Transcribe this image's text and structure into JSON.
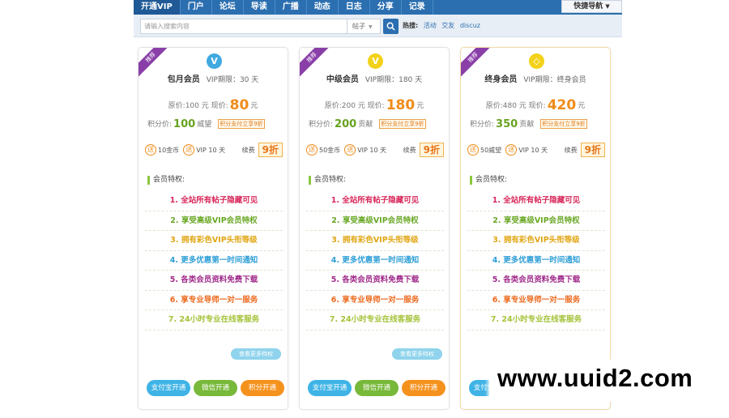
{
  "nav": {
    "items": [
      "开通VIP",
      "门户",
      "论坛",
      "导读",
      "广播",
      "动态",
      "日志",
      "分享",
      "记录"
    ],
    "quick_nav": "快捷导航"
  },
  "search": {
    "placeholder": "请输入搜索内容",
    "scope": "帖子",
    "hot_label": "热搜:",
    "hot_terms": [
      "活动",
      "交友",
      "discuz"
    ]
  },
  "cards": [
    {
      "ribbon": "推荐",
      "badge": "V",
      "badge_color": "#3fa9e0",
      "name": "包月会员",
      "limit": "VIP期限：30 天",
      "orig_price": "原价:100 元 现价:",
      "price": "80",
      "price_unit": "元",
      "points_label": "积分价:",
      "points": "100",
      "points_unit": "威望",
      "pay_tag": "积分支付立享9折",
      "gift1": "10金币",
      "gift2": "VIP 10 天",
      "renew": "续费",
      "discount": "9折",
      "perk_head": "会员特权:",
      "more": "查看更多特权",
      "pay_buttons": [
        "支付宝开通",
        "微信开通",
        "积分开通"
      ]
    },
    {
      "ribbon": "推荐",
      "badge": "V",
      "badge_color": "#f2d21a",
      "name": "中级会员",
      "limit": "VIP期限：180 天",
      "orig_price": "原价:200 元 现价:",
      "price": "180",
      "price_unit": "元",
      "points_label": "积分价:",
      "points": "200",
      "points_unit": "贡献",
      "pay_tag": "积分支付立享9折",
      "gift1": "50金币",
      "gift2": "VIP 10 天",
      "renew": "续费",
      "discount": "9折",
      "perk_head": "会员特权:",
      "more": "查看更多特权",
      "pay_buttons": [
        "支付宝开通",
        "微信开通",
        "积分开通"
      ]
    },
    {
      "ribbon": "推荐",
      "badge": "◇",
      "badge_color": "#f2d21a",
      "name": "终身会员",
      "limit": "VIP期限：终身会员",
      "orig_price": "原价:480 元 现价:",
      "price": "420",
      "price_unit": "元",
      "points_label": "积分价:",
      "points": "350",
      "points_unit": "贡献",
      "pay_tag": "积分支付立享9折",
      "gift1": "50威望",
      "gift2": "VIP 10 天",
      "renew": "续费",
      "discount": "9折",
      "perk_head": "会员特权:",
      "more": "",
      "pay_buttons": [
        "支付宝开通",
        "",
        ""
      ]
    }
  ],
  "perks": [
    {
      "text": "1. 全站所有帖子隐藏可见",
      "color": "#d9285a"
    },
    {
      "text": "2. 享受高级VIP会员特权",
      "color": "#6aa826"
    },
    {
      "text": "3. 拥有彩色VIP头衔等级",
      "color": "#e0a614"
    },
    {
      "text": "4. 更多优惠第一时间通知",
      "color": "#2f9fd6"
    },
    {
      "text": "5. 各类会员资料免费下载",
      "color": "#a02a8a"
    },
    {
      "text": "6. 享专业导师一对一服务",
      "color": "#ec6a1e"
    },
    {
      "text": "7. 24小时专业在线客服务",
      "color": "#a4c238"
    }
  ],
  "pay_colors": [
    "#3fb3e6",
    "#78b83a",
    "#f5921e"
  ],
  "watermark": "www.uuid2.com"
}
